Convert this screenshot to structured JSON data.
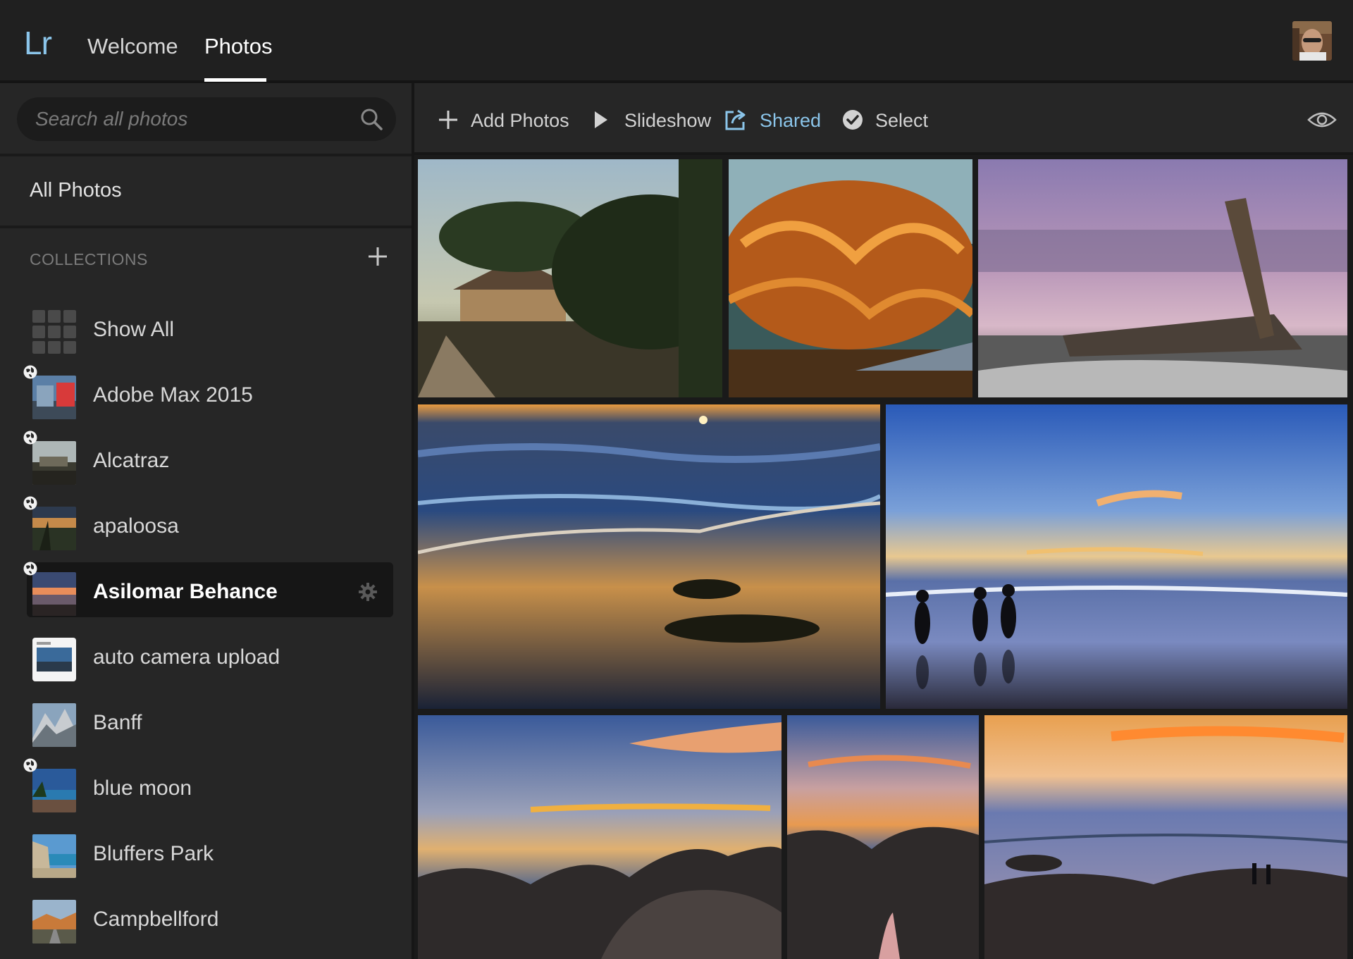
{
  "app": {
    "logo": "Lr"
  },
  "header": {
    "tabs": [
      {
        "label": "Welcome"
      },
      {
        "label": "Photos"
      }
    ],
    "active_tab": "Photos",
    "avatar_icon": "user-avatar"
  },
  "sidebar": {
    "search": {
      "placeholder": "Search all photos",
      "value": ""
    },
    "all_photos_label": "All Photos",
    "collections_heading": "COLLECTIONS",
    "collections": [
      {
        "label": "Show All",
        "shared": false,
        "selected": false
      },
      {
        "label": "Adobe Max 2015",
        "shared": true,
        "selected": false
      },
      {
        "label": "Alcatraz",
        "shared": true,
        "selected": false
      },
      {
        "label": "apaloosa",
        "shared": true,
        "selected": false
      },
      {
        "label": "Asilomar Behance",
        "shared": true,
        "selected": true
      },
      {
        "label": "auto camera upload",
        "shared": false,
        "selected": false
      },
      {
        "label": "Banff",
        "shared": false,
        "selected": false
      },
      {
        "label": "blue moon",
        "shared": true,
        "selected": false
      },
      {
        "label": "Bluffers Park",
        "shared": false,
        "selected": false
      },
      {
        "label": "Campbellford",
        "shared": false,
        "selected": false
      }
    ]
  },
  "toolbar": {
    "add_photos": "Add Photos",
    "slideshow": "Slideshow",
    "shared": "Shared",
    "select": "Select"
  },
  "colors": {
    "accent": "#8bc5ea",
    "background": "#1a1a1a",
    "panel": "#262626",
    "header": "#202020"
  },
  "grid": {
    "photos": [
      {
        "subject": "cypress-house-path"
      },
      {
        "subject": "orange-cypress-tree"
      },
      {
        "subject": "driftwood-purple-sky"
      },
      {
        "subject": "sunset-beach-waves"
      },
      {
        "subject": "people-walking-beach"
      },
      {
        "subject": "sunset-rocks-left"
      },
      {
        "subject": "sunset-rocks-middle"
      },
      {
        "subject": "sunset-rocks-people"
      }
    ]
  }
}
